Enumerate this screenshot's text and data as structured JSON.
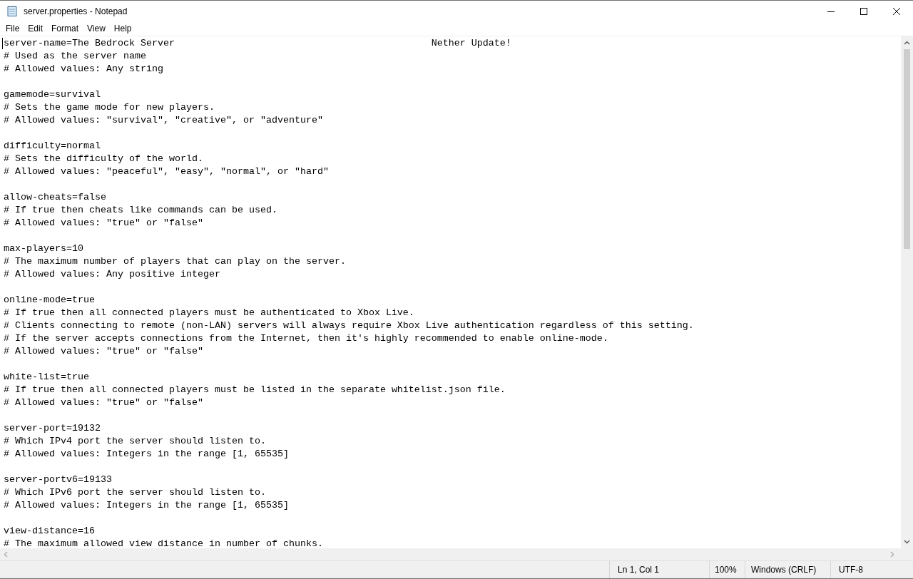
{
  "window": {
    "title": "server.properties - Notepad"
  },
  "menu": [
    "File",
    "Edit",
    "Format",
    "View",
    "Help"
  ],
  "editor": {
    "blocks": [
      [
        "server-name=The Bedrock Server                                             Nether Update!",
        "# Used as the server name",
        "# Allowed values: Any string"
      ],
      [
        "gamemode=survival",
        "# Sets the game mode for new players.",
        "# Allowed values: \"survival\", \"creative\", or \"adventure\""
      ],
      [
        "difficulty=normal",
        "# Sets the difficulty of the world.",
        "# Allowed values: \"peaceful\", \"easy\", \"normal\", or \"hard\""
      ],
      [
        "allow-cheats=false",
        "# If true then cheats like commands can be used.",
        "# Allowed values: \"true\" or \"false\""
      ],
      [
        "max-players=10",
        "# The maximum number of players that can play on the server.",
        "# Allowed values: Any positive integer"
      ],
      [
        "online-mode=true",
        "# If true then all connected players must be authenticated to Xbox Live.",
        "# Clients connecting to remote (non-LAN) servers will always require Xbox Live authentication regardless of this setting.",
        "# If the server accepts connections from the Internet, then it's highly recommended to enable online-mode.",
        "# Allowed values: \"true\" or \"false\""
      ],
      [
        "white-list=true",
        "# If true then all connected players must be listed in the separate whitelist.json file.",
        "# Allowed values: \"true\" or \"false\""
      ],
      [
        "server-port=19132",
        "# Which IPv4 port the server should listen to.",
        "# Allowed values: Integers in the range [1, 65535]"
      ],
      [
        "server-portv6=19133",
        "# Which IPv6 port the server should listen to.",
        "# Allowed values: Integers in the range [1, 65535]"
      ],
      [
        "view-distance=16",
        "# The maximum allowed view distance in number of chunks."
      ]
    ]
  },
  "status_bar": [
    "Ln 1, Col 1",
    "100%",
    "Windows (CRLF)",
    "UTF-8"
  ]
}
